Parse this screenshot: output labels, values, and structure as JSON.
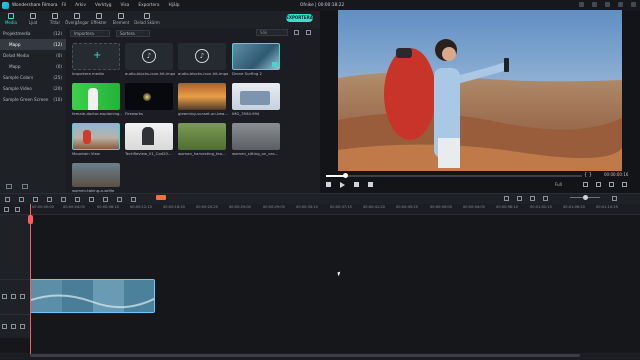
{
  "app": {
    "title": "Wondershare Filmora",
    "project_title": "Ofnike | 00:00:18:22",
    "menu": [
      "Fil",
      "Arkiv",
      "Verktyg",
      "Visa",
      "Exportera",
      "Hjälp"
    ]
  },
  "toolbar": {
    "tabs": [
      "Media",
      "Ljud",
      "Titlar",
      "Övergångar",
      "Effekter",
      "Element",
      "Delad Skärm"
    ],
    "export": "EXPORTERA"
  },
  "tree": [
    {
      "label": "Projektmedia",
      "count": "(12)"
    },
    {
      "label": "Mapp",
      "count": "(12)"
    },
    {
      "label": "Delad Media",
      "count": "(0)"
    },
    {
      "label": "Mapp",
      "count": "(0)"
    },
    {
      "label": "Sample Colors",
      "count": "(25)"
    },
    {
      "label": "Sample Video",
      "count": "(20)"
    },
    {
      "label": "Sample Green Screen",
      "count": "(10)"
    }
  ],
  "media": {
    "import_label": "Importera",
    "sort_label": "Sortera",
    "search_placeholder": "Sök",
    "import_media": "Importera media",
    "items": [
      "audio-blocks-icon-hit-impa…",
      "audio-blocks-icon-hit-impa…",
      "Drone Surfing 2",
      "female-doctor-explaining…",
      "Fireworks",
      "gleaming-sunset-on-bea…",
      "IMG_3564.994",
      "Mountain View",
      "TechReview_01_Cod20…",
      "woman_harvesting_tea…",
      "women_sitting_on_cas…",
      "women-taking-a-selfie"
    ]
  },
  "preview": {
    "timecode": "00:00:00:16",
    "quality": "Full"
  },
  "ruler": [
    "00:00:00:00",
    "00:00:04:05",
    "00:00:08:10",
    "00:00:12:15",
    "00:00:16:20",
    "00:00:20:25",
    "00:00:25:00",
    "00:00:29:05",
    "00:00:33:10",
    "00:00:37:15",
    "00:00:41:20",
    "00:00:45:25",
    "00:00:50:00",
    "00:00:54:05",
    "00:00:58:10",
    "00:01:02:15",
    "00:01:06:20",
    "00:01:10:25",
    "00:01:15:00"
  ],
  "colors": {
    "accent": "#35e0cf",
    "playhead": "#ff5b5b",
    "clip_border": "#6cc6ff"
  },
  "icons": [
    "play-icon",
    "stop-icon",
    "snapshot-icon",
    "fullscreen-icon",
    "undo-icon",
    "redo-icon",
    "delete-icon",
    "split-icon",
    "folder-icon",
    "filter-icon",
    "grid-icon"
  ]
}
